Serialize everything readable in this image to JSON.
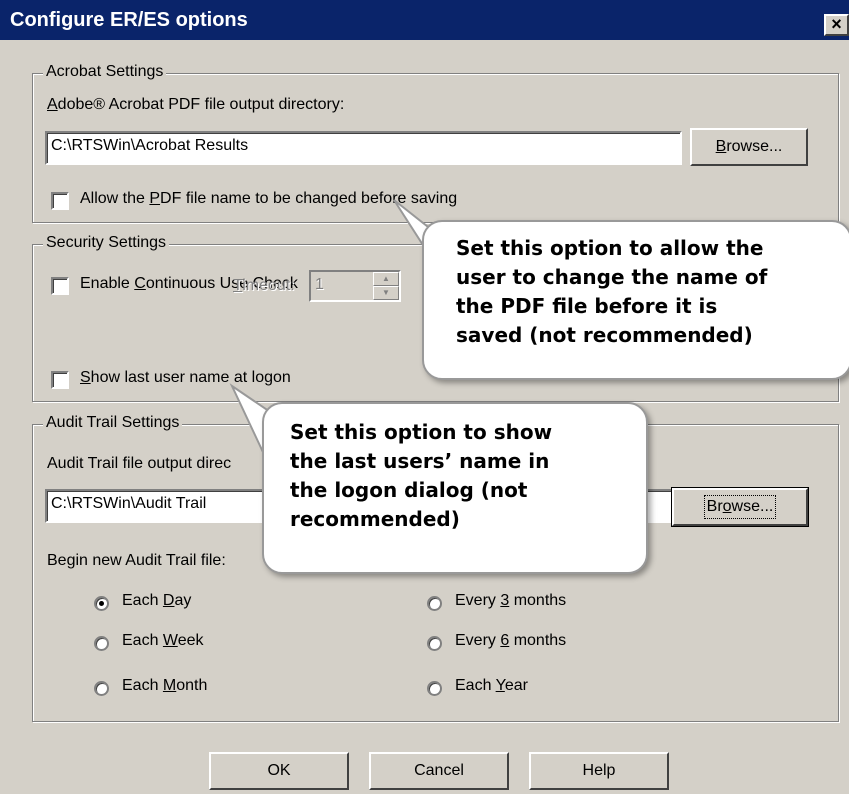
{
  "window": {
    "title": "Configure ER/ES options",
    "close_label": "×"
  },
  "acrobat": {
    "legend": "Acrobat Settings",
    "dir_label_a": "A",
    "dir_label_rest": "dobe® Acrobat PDF file output directory:",
    "dir_value": "C:\\RTSWin\\Acrobat Results",
    "browse_pre": "",
    "browse_u": "B",
    "browse_post": "rowse...",
    "allow_pre": "Allow the ",
    "allow_u": "P",
    "allow_post": "DF file name to be changed before saving"
  },
  "security": {
    "legend": "Security Settings",
    "continuous_pre": "Enable ",
    "continuous_u": "C",
    "continuous_post": "ontinuous Use Check",
    "timeout_u": "T",
    "timeout_post": "imeout:",
    "timeout_value": "1",
    "showlast_pre": "",
    "showlast_u": "S",
    "showlast_post": "how last user name at logon"
  },
  "audit": {
    "legend": "Audit Trail Settings",
    "dir_label": "Audit Trail file output direc",
    "dir_value": "C:\\RTSWin\\Audit Trail",
    "browse_pre": "Br",
    "browse_u": "o",
    "browse_post": "wse...",
    "begin_label": "Begin new Audit Trail file:",
    "options": {
      "day_pre": "Each ",
      "day_u": "D",
      "day_post": "ay",
      "week_pre": "Each ",
      "week_u": "W",
      "week_post": "eek",
      "month_pre": "Each ",
      "month_u": "M",
      "month_post": "onth",
      "m3_pre": "Every ",
      "m3_u": "3",
      "m3_post": " months",
      "m6_pre": "Every ",
      "m6_u": "6",
      "m6_post": " months",
      "year_pre": "Each ",
      "year_u": "Y",
      "year_post": "ear"
    },
    "selected": "Each Day"
  },
  "footer": {
    "ok": "OK",
    "cancel": "Cancel",
    "help": "Help"
  },
  "callouts": {
    "pdf_name": [
      "Set this option to allow the",
      "user to change the name of",
      "the PDF file before it is",
      "saved (not recommended)"
    ],
    "last_user": [
      "Set this option to show",
      "the last users’ name in",
      "the logon dialog (not",
      "recommended)"
    ]
  },
  "colors": {
    "titlebar": "#0a246a",
    "dialog_bg": "#d4d0c8",
    "callout_bg": "#ffffff"
  }
}
